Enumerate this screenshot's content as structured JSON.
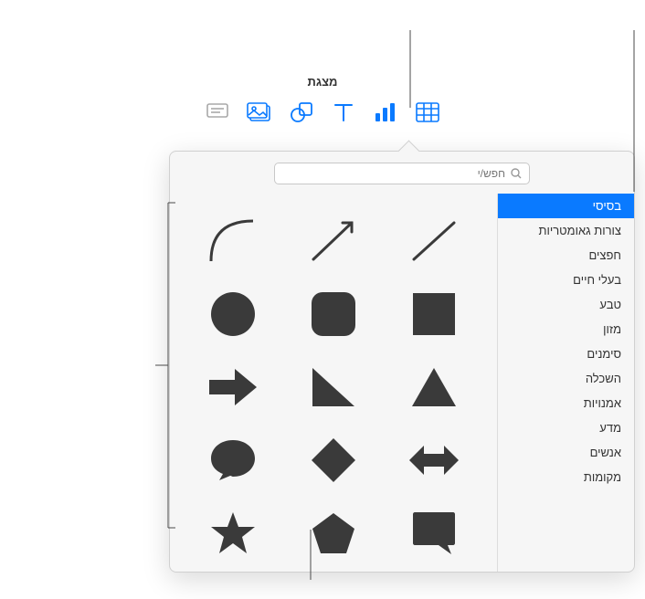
{
  "title": "מצגת",
  "toolbar": {
    "table": "table-icon",
    "chart": "chart-icon",
    "text": "text-icon",
    "shape": "shape-icon",
    "media": "media-icon",
    "comment": "comment-icon"
  },
  "search": {
    "placeholder": "חפש/י"
  },
  "categories": [
    {
      "label": "בסיסי",
      "selected": true
    },
    {
      "label": "צורות גאומטריות",
      "selected": false
    },
    {
      "label": "חפצים",
      "selected": false
    },
    {
      "label": "בעלי חיים",
      "selected": false
    },
    {
      "label": "טבע",
      "selected": false
    },
    {
      "label": "מזון",
      "selected": false
    },
    {
      "label": "סימנים",
      "selected": false
    },
    {
      "label": "השכלה",
      "selected": false
    },
    {
      "label": "אמנויות",
      "selected": false
    },
    {
      "label": "מדע",
      "selected": false
    },
    {
      "label": "אנשים",
      "selected": false
    },
    {
      "label": "מקומות",
      "selected": false
    }
  ],
  "shapes": [
    "curve",
    "arrow-line",
    "line",
    "circle",
    "rounded-square",
    "square",
    "arrow-right",
    "right-triangle",
    "triangle",
    "speech-bubble",
    "diamond",
    "double-arrow",
    "star",
    "pentagon",
    "callout-square"
  ]
}
